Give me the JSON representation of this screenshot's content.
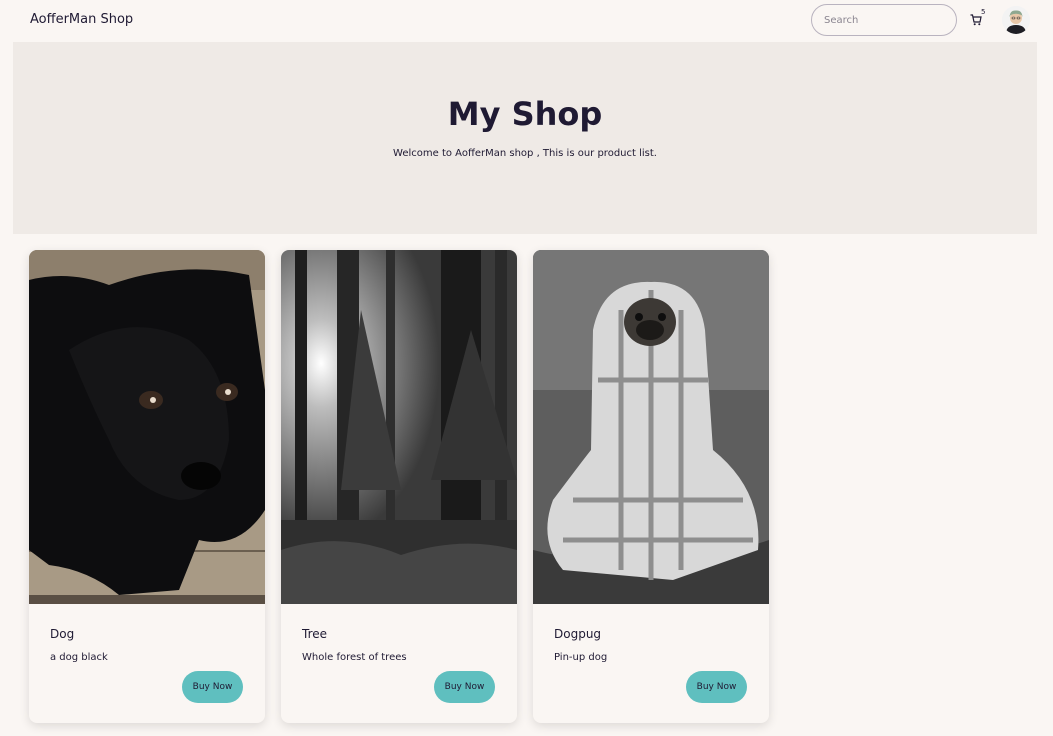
{
  "navbar": {
    "brand": "AofferMan Shop",
    "search_placeholder": "Search",
    "cart_count": "5"
  },
  "hero": {
    "title": "My Shop",
    "subtitle": "Welcome to AofferMan shop , This is our product list."
  },
  "products": [
    {
      "title": "Dog",
      "description": "a dog black",
      "button": "Buy Now"
    },
    {
      "title": "Tree",
      "description": "Whole forest of trees",
      "button": "Buy Now"
    },
    {
      "title": "Dogpug",
      "description": "Pin-up dog",
      "button": "Buy Now"
    }
  ],
  "icons": {
    "cart": "cart-icon",
    "avatar": "user-avatar"
  },
  "colors": {
    "accent": "#5fbfbf",
    "hero_bg": "#efeae6",
    "page_bg": "#faf6f3",
    "text": "#1f1a33"
  }
}
